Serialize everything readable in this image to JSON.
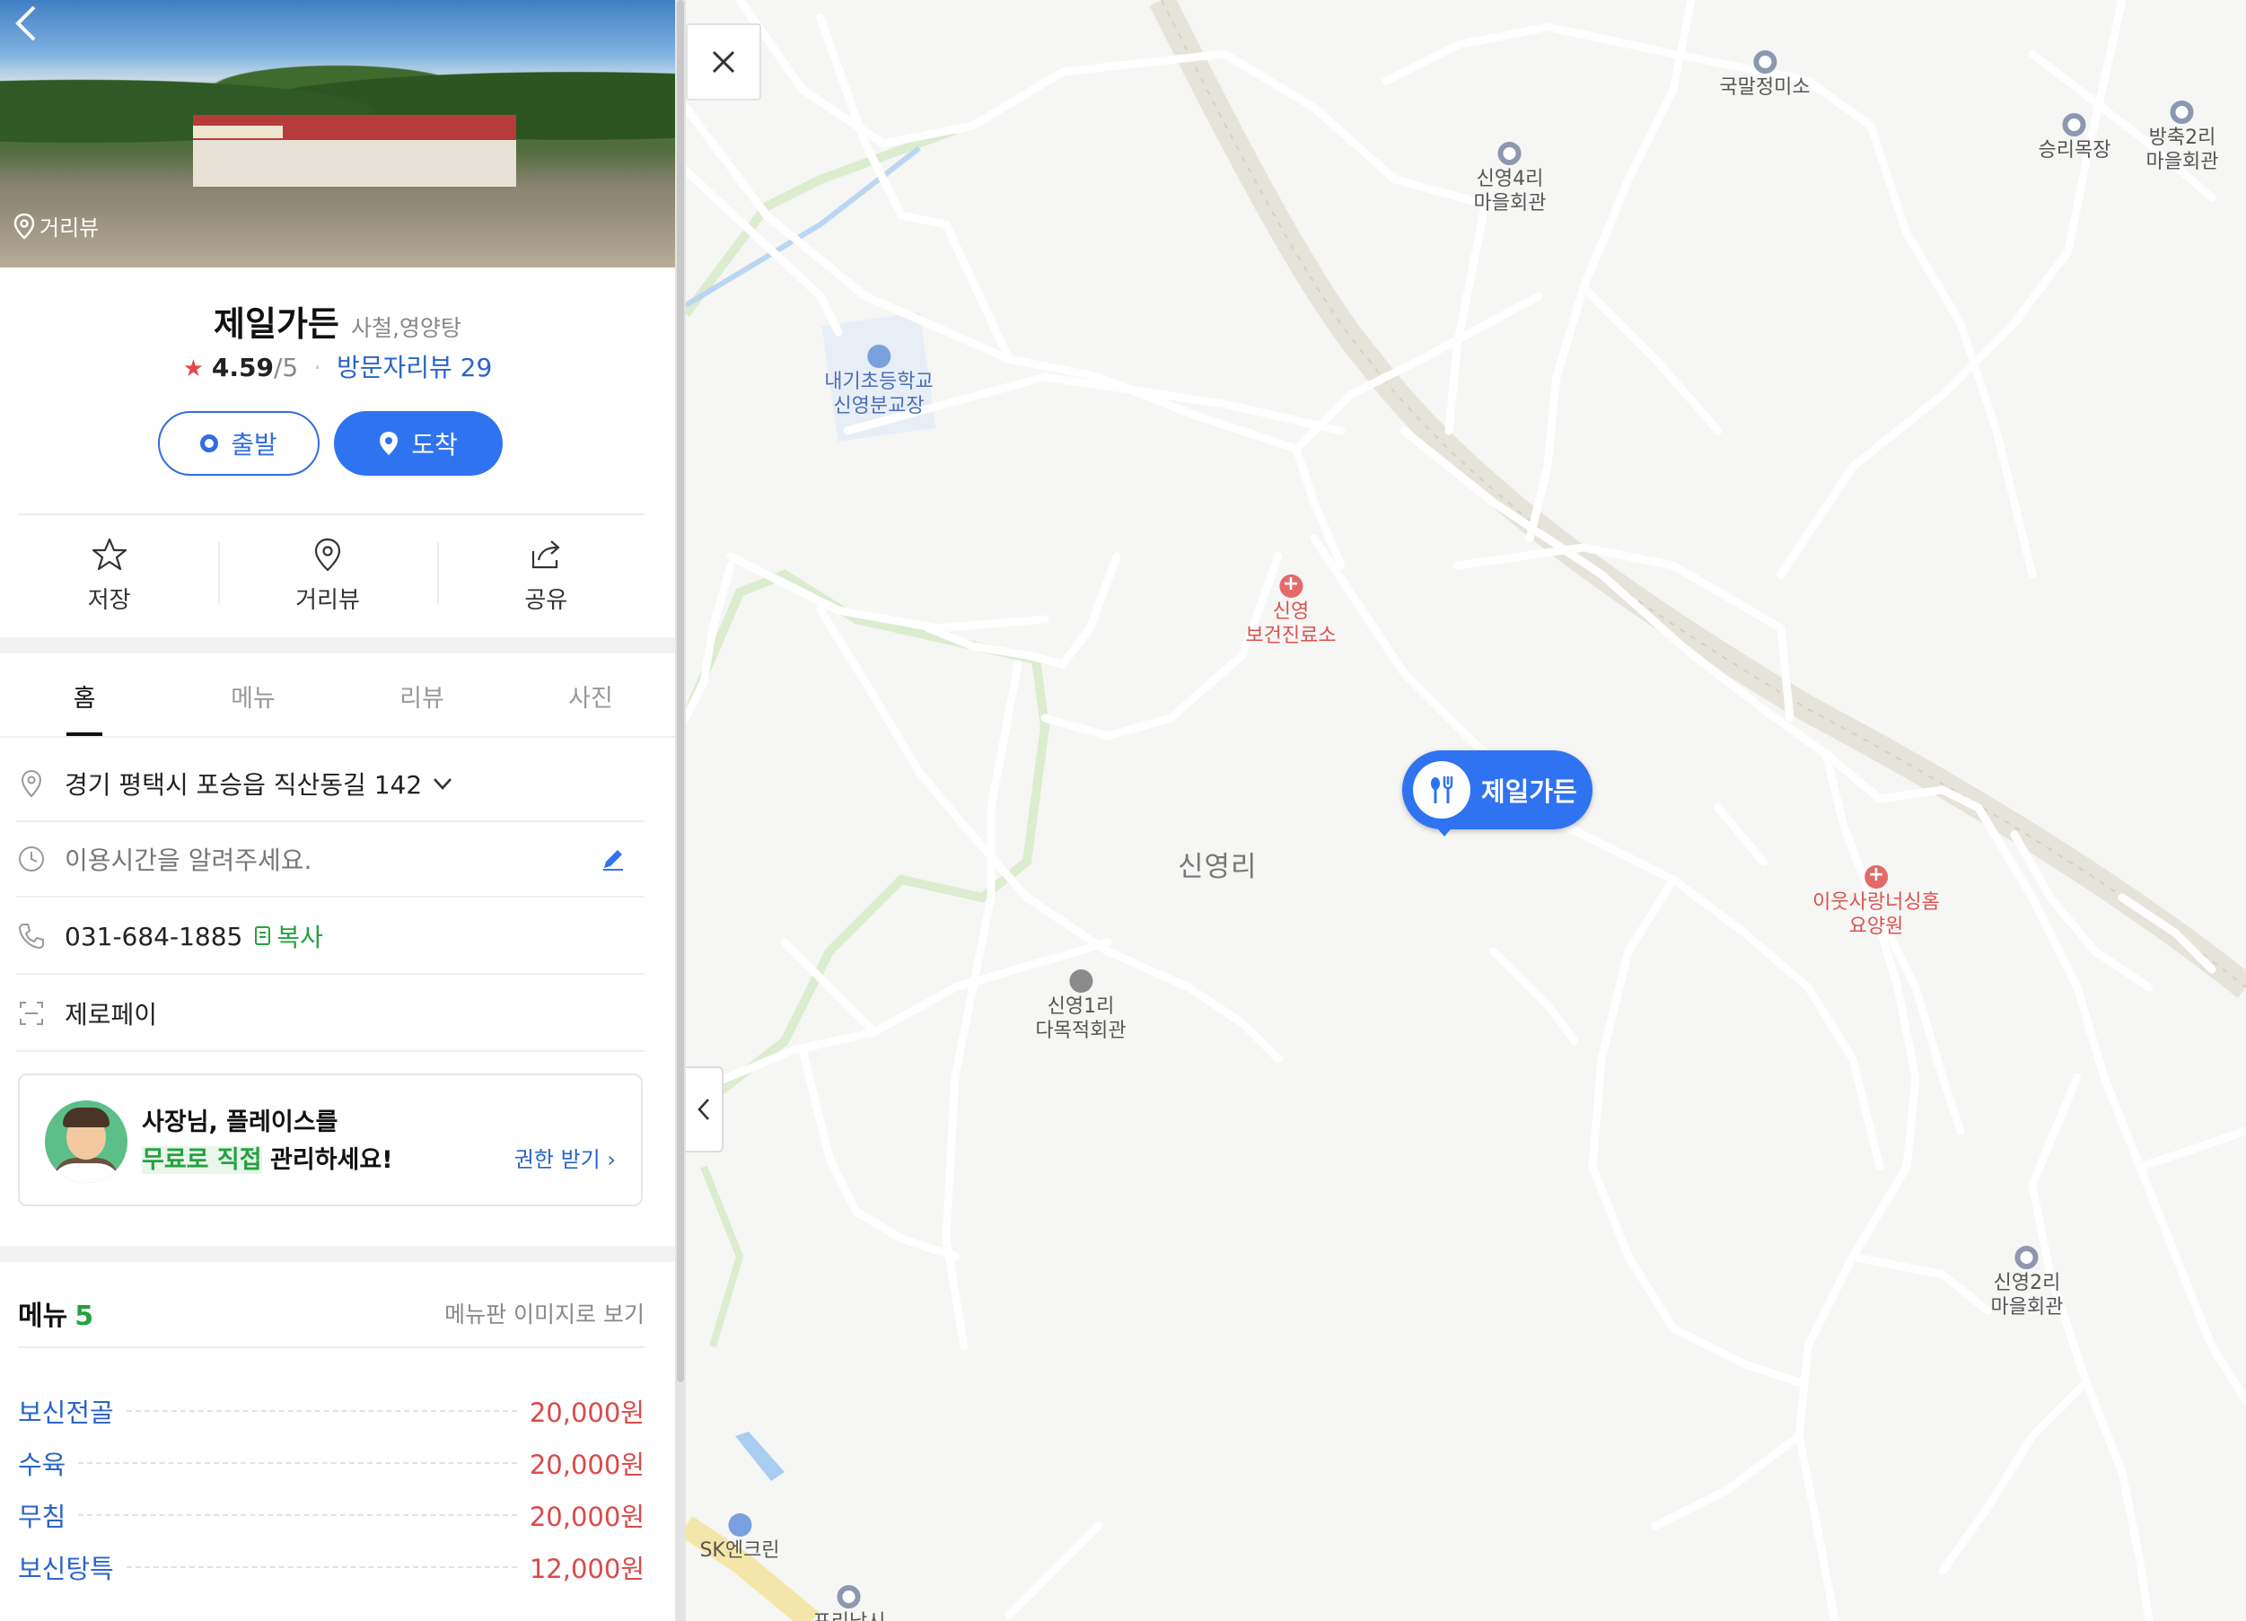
{
  "photo": {
    "back_icon": "chevron-left-icon",
    "streetview_label": "거리뷰"
  },
  "place": {
    "name": "제일가든",
    "category": "사철,영양탕",
    "rating_star": "★",
    "rating": "4.59",
    "rating_max": "/5",
    "rating_sep": "·",
    "review_link": "방문자리뷰 29"
  },
  "route": {
    "start_label": "출발",
    "arrive_label": "도착"
  },
  "actions": [
    {
      "label": "저장",
      "icon": "star-icon"
    },
    {
      "label": "거리뷰",
      "icon": "map-pin-icon"
    },
    {
      "label": "공유",
      "icon": "share-icon"
    }
  ],
  "tabs": [
    "홈",
    "메뉴",
    "리뷰",
    "사진"
  ],
  "active_tab": "홈",
  "info": {
    "address": "경기 평택시 포승읍 직산동길 142",
    "hours_placeholder": "이용시간을 알려주세요.",
    "phone": "031-684-1885",
    "copy_label": "복사",
    "payment": "제로페이"
  },
  "owner_promo": {
    "line1": "사장님, 플레이스를",
    "line2_highlight": "무료로 직접",
    "line2_rest": " 관리하세요!",
    "link": "권한 받기 ›"
  },
  "menu": {
    "title": "메뉴",
    "count": "5",
    "image_link": "메뉴판 이미지로 보기",
    "items": [
      {
        "name": "보신전골",
        "price": "20,000원"
      },
      {
        "name": "수육",
        "price": "20,000원"
      },
      {
        "name": "무침",
        "price": "20,000원"
      },
      {
        "name": "보신탕특",
        "price": "12,000원"
      }
    ]
  },
  "map": {
    "area_label": "신영리",
    "marker_label": "제일가든",
    "pois": [
      {
        "name": "국말정미소",
        "type": "place"
      },
      {
        "name": "승리목장",
        "type": "place"
      },
      {
        "name": "방축2리\n마을회관",
        "type": "place"
      },
      {
        "name": "신영4리\n마을회관",
        "type": "place"
      },
      {
        "name": "내기초등학교\n신영분교장",
        "type": "school"
      },
      {
        "name": "신영\n보건진료소",
        "type": "medical"
      },
      {
        "name": "이웃사랑너싱홈\n요양원",
        "type": "medical"
      },
      {
        "name": "신영1리\n다목적회관",
        "type": "center"
      },
      {
        "name": "신영2리\n마을회관",
        "type": "place"
      },
      {
        "name": "SK엔크린",
        "type": "gas"
      },
      {
        "name": "포리낚시",
        "type": "place"
      }
    ]
  },
  "colors": {
    "brand_blue": "#2f73f0",
    "link_blue": "#2b64c9",
    "price_red": "#d94a4a",
    "accent_green": "#25a140"
  }
}
